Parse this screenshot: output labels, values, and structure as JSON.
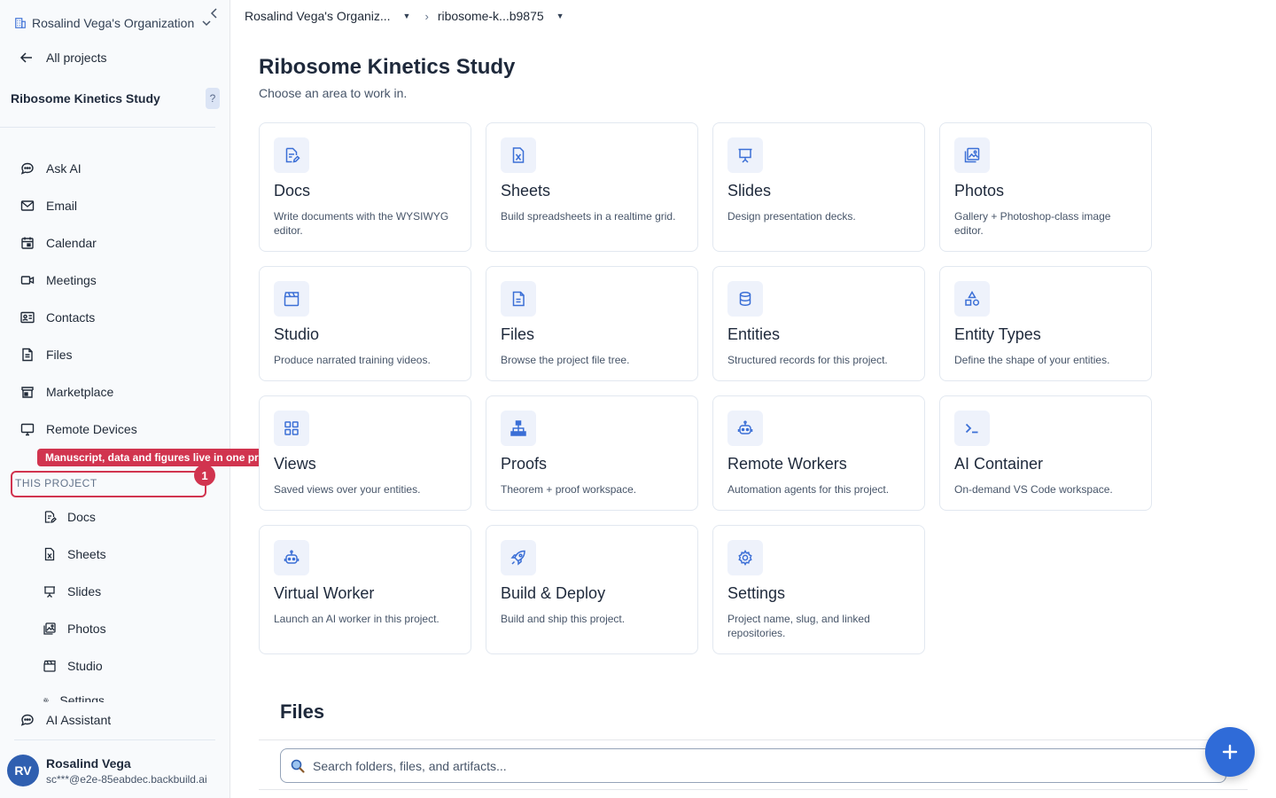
{
  "sidebar": {
    "org_name": "Rosalind Vega's Organization",
    "back_label": "All projects",
    "project_name": "Ribosome Kinetics Study",
    "help_label": "?",
    "nav": [
      "Ask AI",
      "Email",
      "Calendar",
      "Meetings",
      "Contacts",
      "Files",
      "Marketplace",
      "Remote Devices"
    ],
    "section_label": "THIS PROJECT",
    "tooltip": "Manuscript, data and figures live in one project",
    "step_number": "1",
    "sub_items": [
      "Docs",
      "Sheets",
      "Slides",
      "Photos",
      "Studio",
      "Settings"
    ],
    "ai_assistant": "AI Assistant",
    "user": {
      "initials": "RV",
      "name": "Rosalind Vega",
      "email": "sc***@e2e-85eabdec.backbuild.ai"
    }
  },
  "breadcrumb": {
    "org": "Rosalind Vega's Organiz...",
    "project": "ribosome-k...b9875"
  },
  "main": {
    "title": "Ribosome Kinetics Study",
    "subtitle": "Choose an area to work in.",
    "cards": [
      {
        "title": "Docs",
        "desc": "Write documents with the WYSIWYG editor.",
        "icon": "doc-edit-icon"
      },
      {
        "title": "Sheets",
        "desc": "Build spreadsheets in a realtime grid.",
        "icon": "spreadsheet-icon"
      },
      {
        "title": "Slides",
        "desc": "Design presentation decks.",
        "icon": "presentation-icon"
      },
      {
        "title": "Photos",
        "desc": "Gallery + Photoshop-class image editor.",
        "icon": "photo-icon"
      },
      {
        "title": "Studio",
        "desc": "Produce narrated training videos.",
        "icon": "clapperboard-icon"
      },
      {
        "title": "Files",
        "desc": "Browse the project file tree.",
        "icon": "file-icon"
      },
      {
        "title": "Entities",
        "desc": "Structured records for this project.",
        "icon": "database-icon"
      },
      {
        "title": "Entity Types",
        "desc": "Define the shape of your entities.",
        "icon": "shapes-icon"
      },
      {
        "title": "Views",
        "desc": "Saved views over your entities.",
        "icon": "grid-icon"
      },
      {
        "title": "Proofs",
        "desc": "Theorem + proof workspace.",
        "icon": "hierarchy-icon"
      },
      {
        "title": "Remote Workers",
        "desc": "Automation agents for this project.",
        "icon": "robot-icon"
      },
      {
        "title": "AI Container",
        "desc": "On-demand VS Code workspace.",
        "icon": "terminal-icon"
      },
      {
        "title": "Virtual Worker",
        "desc": "Launch an AI worker in this project.",
        "icon": "robot-icon"
      },
      {
        "title": "Build & Deploy",
        "desc": "Build and ship this project.",
        "icon": "rocket-icon"
      },
      {
        "title": "Settings",
        "desc": "Project name, slug, and linked repositories.",
        "icon": "gear-icon"
      }
    ],
    "files_title": "Files",
    "search_placeholder": "Search folders, files, and artifacts..."
  },
  "colors": {
    "accent": "#2f6bd8",
    "highlight": "#d1344f",
    "icon_bg": "#eef2fb"
  }
}
